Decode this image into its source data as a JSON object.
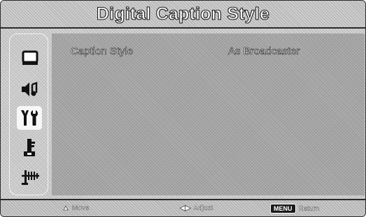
{
  "header": {
    "title": "Digital Caption Style"
  },
  "sidebar": {
    "items": [
      {
        "icon": "picture-icon"
      },
      {
        "icon": "sound-icon"
      },
      {
        "icon": "setup-tools-icon",
        "selected": true
      },
      {
        "icon": "lock-key-icon"
      },
      {
        "icon": "antenna-icon"
      }
    ]
  },
  "main": {
    "rows": [
      {
        "label": "Caption Style",
        "value": "As Broadcaster"
      }
    ]
  },
  "footer": {
    "move_label": "Move",
    "adjust_label": "Adjust",
    "menu_key": "MENU",
    "return_label": "Return"
  }
}
